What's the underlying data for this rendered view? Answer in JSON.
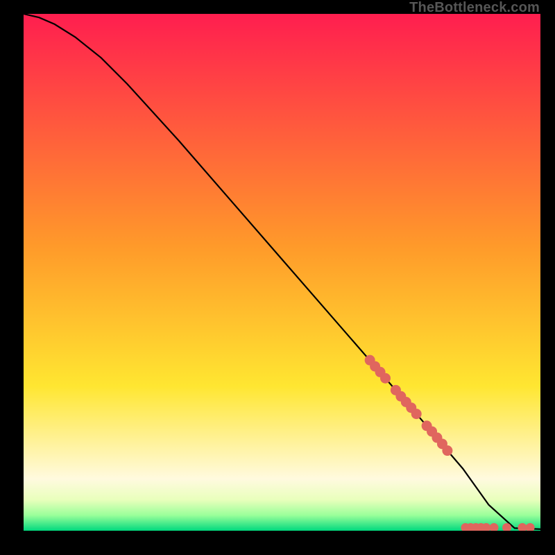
{
  "attribution": "TheBottleneck.com",
  "colors": {
    "top": "#ff1e4f",
    "mid1": "#ff9a2a",
    "mid2": "#ffe631",
    "low1": "#fffadf",
    "low2": "#e9ffbc",
    "low3": "#9aff9a",
    "bottom": "#00d97e",
    "curve": "#000000",
    "marker": "#e0665e"
  },
  "chart_data": {
    "type": "line",
    "title": "",
    "xlabel": "",
    "ylabel": "",
    "xlim": [
      0,
      100
    ],
    "ylim": [
      0,
      100
    ],
    "curve": {
      "x": [
        0,
        3,
        6,
        10,
        15,
        20,
        30,
        40,
        50,
        60,
        70,
        80,
        82,
        85,
        90,
        95,
        100
      ],
      "y": [
        100,
        99.3,
        98.0,
        95.5,
        91.5,
        86.5,
        75.5,
        64.0,
        52.5,
        41.0,
        29.5,
        18.0,
        15.5,
        12.0,
        5.0,
        0.5,
        0.3
      ]
    },
    "markers_on_curve": {
      "x": [
        67,
        68,
        69,
        70,
        72,
        73,
        74,
        75,
        76,
        78,
        79,
        80,
        81,
        82
      ],
      "y": [
        33.0,
        31.8,
        30.7,
        29.5,
        27.2,
        26.0,
        24.9,
        23.8,
        22.6,
        20.3,
        19.2,
        18.0,
        16.8,
        15.5
      ]
    },
    "markers_flat": {
      "x": [
        85.5,
        86.5,
        87.5,
        88.5,
        89.5,
        91.0,
        93.5,
        96.5,
        98.0
      ],
      "y": [
        0.6,
        0.6,
        0.6,
        0.6,
        0.6,
        0.6,
        0.6,
        0.6,
        0.6
      ]
    }
  }
}
